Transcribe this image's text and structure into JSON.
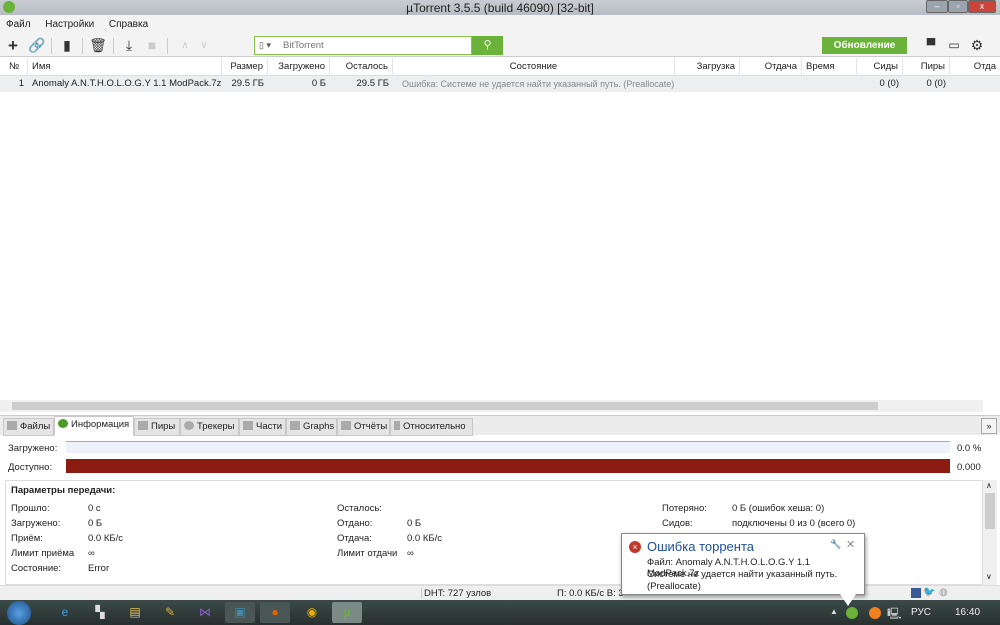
{
  "window": {
    "title": "µTorrent 3.5.5  (build 46090) [32-bit]",
    "minimize": "–",
    "maximize": "▫",
    "close": "x"
  },
  "menu": [
    "Файл",
    "Настройки",
    "Справка"
  ],
  "toolbar": {
    "search_placeholder": "BitTorrent",
    "update_label": "Обновление"
  },
  "columns": [
    "№",
    "Имя",
    "Размер",
    "Загружено",
    "Осталось",
    "Состояние",
    "Загрузка",
    "Отдача",
    "Время",
    "Сиды",
    "Пиры",
    "Отда"
  ],
  "torrents": [
    {
      "num": "1",
      "name": "Anomaly A.N.T.H.O.L.O.G.Y 1.1 ModPack.7z",
      "size": "29.5 ГБ",
      "downloaded": "0 Б",
      "remaining": "29.5 ГБ",
      "status": "Ошибка: Системе не удается найти указанный путь.  (Preallocate)",
      "down": "",
      "up": "",
      "time": "",
      "seeds": "0 (0)",
      "peers": "0 (0)",
      "uploaded": ""
    }
  ],
  "tabs": [
    "Файлы",
    "Информация",
    "Пиры",
    "Трекеры",
    "Части",
    "Graphs",
    "Отчёты",
    "Относительно"
  ],
  "active_tab": "Информация",
  "progress": {
    "downloaded_label": "Загружено:",
    "downloaded_value": "0.0 %",
    "downloaded_fraction": 0.0,
    "available_label": "Доступно:",
    "available_value": "0.000",
    "available_color": "#8b1a10"
  },
  "params": {
    "title": "Параметры передачи:",
    "col1": [
      [
        "Прошло:",
        "0 с"
      ],
      [
        "Загружено:",
        "0 Б"
      ],
      [
        "Приём:",
        "0.0 КБ/с"
      ],
      [
        "Лимит приёма",
        "∞"
      ],
      [
        "Состояние:",
        "Error"
      ]
    ],
    "col2": [
      [
        "Осталось:",
        ""
      ],
      [
        "Отдано:",
        "0 Б"
      ],
      [
        "Отдача:",
        "0.0 КБ/с"
      ],
      [
        "Лимит отдачи",
        "∞"
      ]
    ],
    "col3": [
      [
        "Потеряно:",
        "0 Б (ошибок хеша: 0)"
      ],
      [
        "Сидов:",
        "подключены 0 из 0 (всего 0)"
      ]
    ]
  },
  "statusbar": {
    "dht": "DHT: 727 узлов",
    "speed": "П: 0.0 КБ/с В: 3"
  },
  "notification": {
    "title": "Ошибка торрента",
    "line1": "Файл: Anomaly A.N.T.H.O.L.O.G.Y 1.1 ModPack.7z",
    "line2": "Системе не удается найти указанный путь.",
    "line3": "(Preallocate)"
  },
  "taskbar": {
    "lang": "РУС",
    "time": "16:40"
  },
  "colors": {
    "accent": "#6ab23a",
    "error": "#c0392b"
  }
}
